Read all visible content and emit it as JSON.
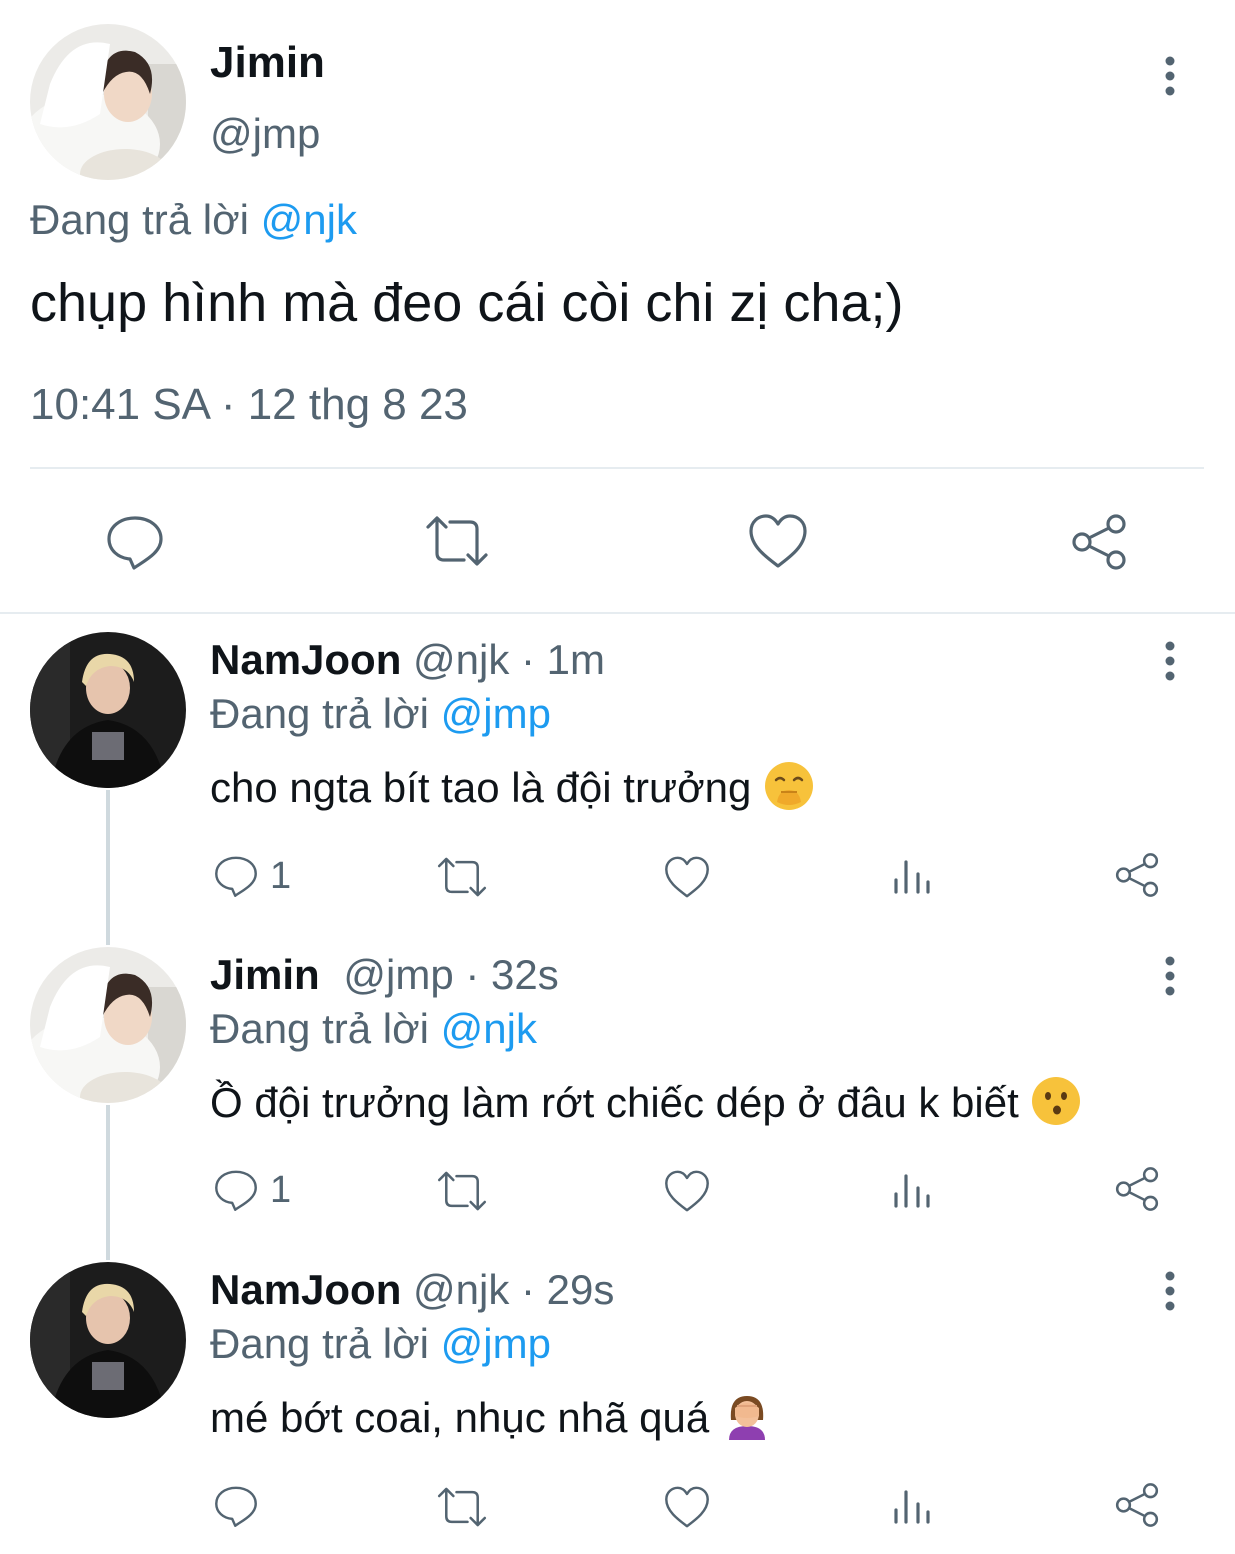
{
  "main_tweet": {
    "display_name": "Jimin",
    "handle": "@jmp",
    "reply_prefix": "Đang trả lời",
    "reply_to": "@njk",
    "text": "chụp hình mà đeo cái còi chi zị cha;)",
    "timestamp": "10:41 SA · 12 thg 8 23"
  },
  "replies": [
    {
      "display_name": "NamJoon",
      "handle_time": "@njk · 1m",
      "reply_prefix": "Đang trả lời",
      "reply_to": "@jmp",
      "text": "cho ngta bít tao là đội trưởng",
      "emoji_icon": "face-with-hand-over-mouth",
      "reply_count": "1"
    },
    {
      "display_name": "Jimin",
      "handle_time": "@jmp · 32s",
      "reply_prefix": "Đang trả lời",
      "reply_to": "@njk",
      "text": "Ồ đội trưởng làm rớt chiếc dép ở đâu k biết",
      "emoji_icon": "kissing-face",
      "reply_count": "1"
    },
    {
      "display_name": "NamJoon",
      "handle_time": "@njk · 29s",
      "reply_prefix": "Đang trả lời",
      "reply_to": "@jmp",
      "text": "mé bớt coai, nhục nhã quá",
      "emoji_icon": "person-facepalming",
      "reply_count": ""
    }
  ],
  "colors": {
    "text": "#0f1419",
    "secondary": "#536471",
    "link": "#1d9bf0",
    "divider": "#e6ecf0",
    "thread_line": "#cfd9de"
  }
}
